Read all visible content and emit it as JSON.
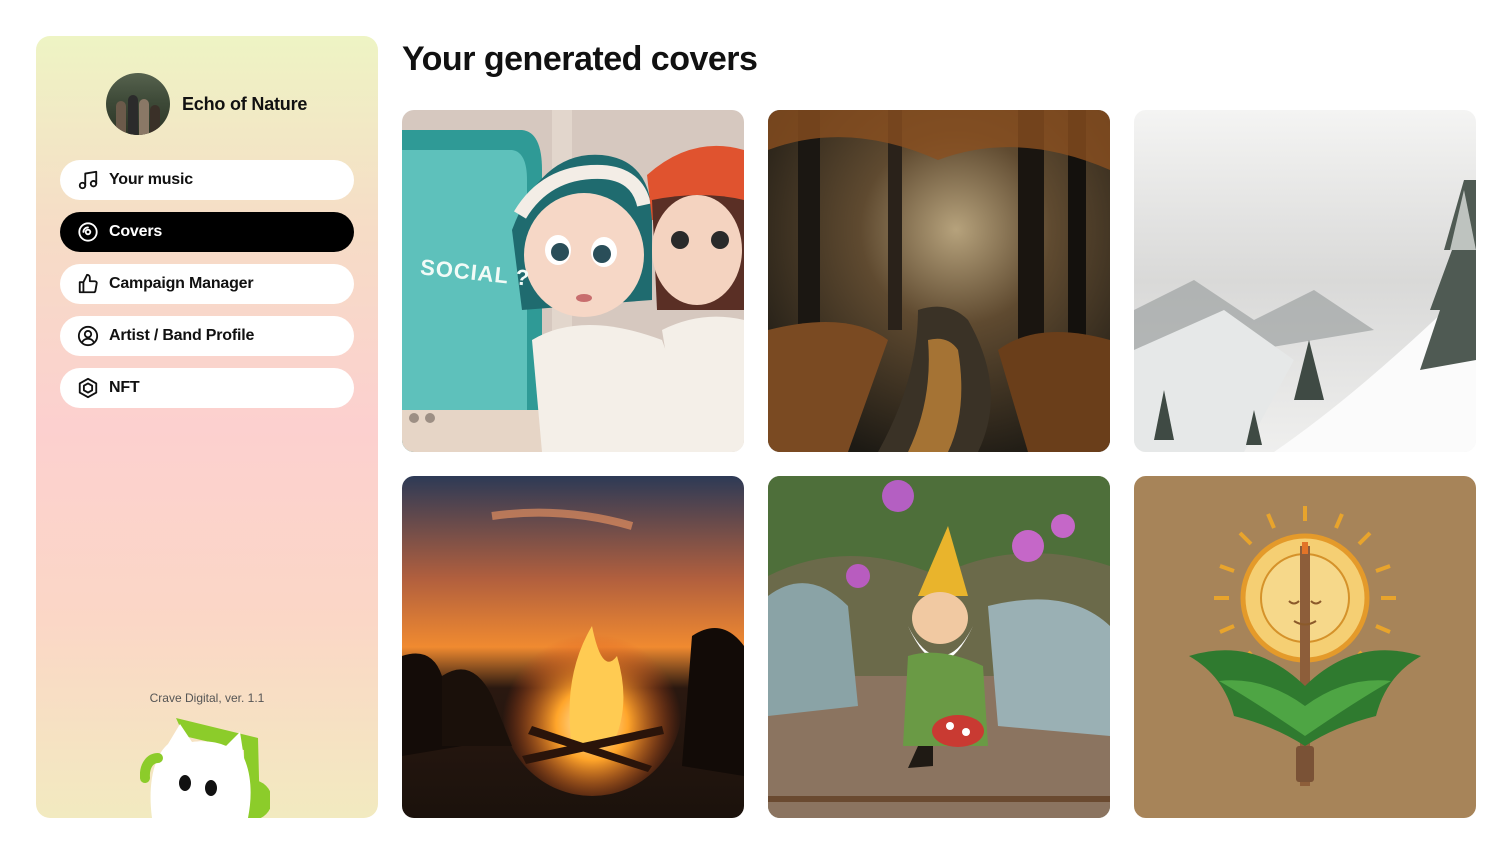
{
  "profile": {
    "name": "Echo of Nature"
  },
  "nav": {
    "items": [
      {
        "label": "Your music",
        "icon": "music-note-icon"
      },
      {
        "label": "Covers",
        "icon": "disc-icon",
        "active": true
      },
      {
        "label": "Campaign Manager",
        "icon": "thumbs-up-icon"
      },
      {
        "label": "Artist / Band Profile",
        "icon": "user-circle-icon"
      },
      {
        "label": "NFT",
        "icon": "nft-hexagon-icon"
      }
    ]
  },
  "footer": {
    "version": "Crave Digital, ver. 1.1"
  },
  "main": {
    "title": "Your generated covers",
    "covers": [
      {
        "name": "cover-retro-tv-girls",
        "text": "SOCIAL ?"
      },
      {
        "name": "cover-autumn-forest-stream"
      },
      {
        "name": "cover-snowy-mountains"
      },
      {
        "name": "cover-campfire-sunset"
      },
      {
        "name": "cover-garden-gnome"
      },
      {
        "name": "cover-sun-guitar-emblem"
      }
    ]
  },
  "colors": {
    "active_nav_bg": "#000000",
    "mascot_green": "#8ccc2a"
  }
}
